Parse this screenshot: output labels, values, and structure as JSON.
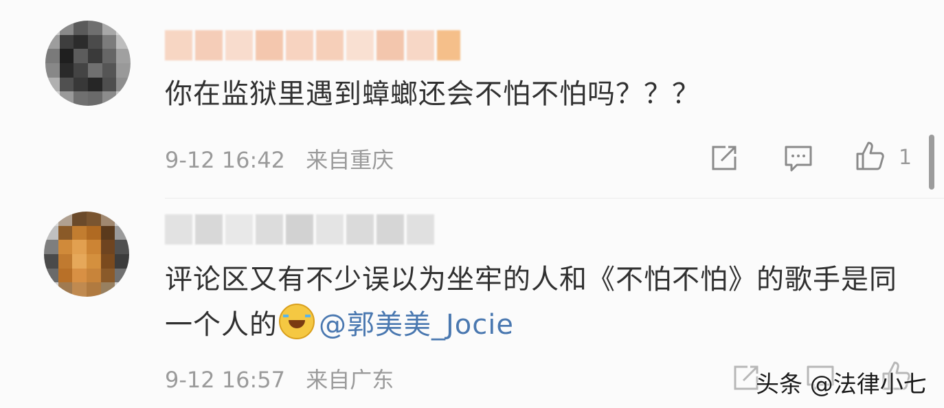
{
  "comments": [
    {
      "text": "你在监狱里遇到蟑螂还会不怕不怕吗？？？",
      "date": "9-12 16:42",
      "location": "来自重庆",
      "like_count": "1"
    },
    {
      "text": "评论区又有不少误以为坐牢的人和《不怕不怕》的歌手是同一个人的",
      "mention": "@郭美美_Jocie",
      "date": "9-12 16:57",
      "location": "来自广东"
    }
  ],
  "icons": {
    "share": "share-icon",
    "comment": "comment-icon",
    "like": "thumbs-up-icon",
    "emoji": "laugh-cry-emoji-icon"
  },
  "watermark": "头条 @法律小七",
  "colors": {
    "text": "#303030",
    "meta": "#9a9a9a",
    "mention": "#4a78b0"
  }
}
